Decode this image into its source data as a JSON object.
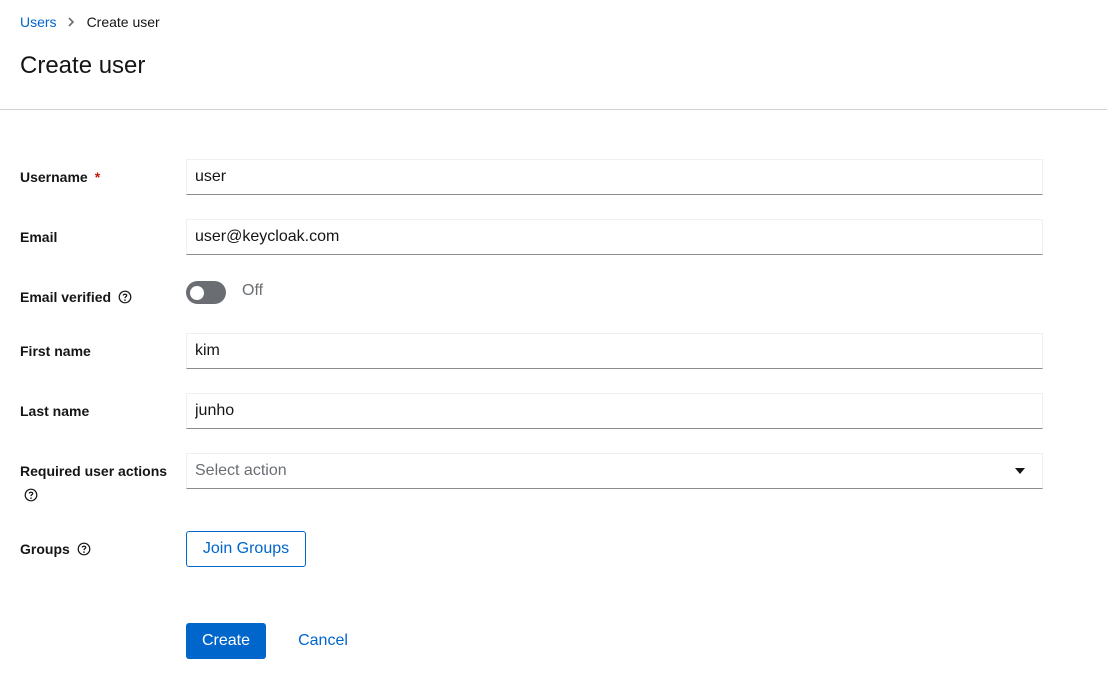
{
  "breadcrumb": {
    "parent": "Users",
    "current": "Create user"
  },
  "page": {
    "title": "Create user"
  },
  "form": {
    "username": {
      "label": "Username",
      "required_mark": "*",
      "value": "user"
    },
    "email": {
      "label": "Email",
      "value": "user@keycloak.com"
    },
    "email_verified": {
      "label": "Email verified",
      "state_text": "Off",
      "on": false
    },
    "first_name": {
      "label": "First name",
      "value": "kim"
    },
    "last_name": {
      "label": "Last name",
      "value": "junho"
    },
    "required_actions": {
      "label": "Required user actions",
      "placeholder": "Select action"
    },
    "groups": {
      "label": "Groups",
      "button_label": "Join Groups"
    }
  },
  "actions": {
    "create_label": "Create",
    "cancel_label": "Cancel"
  },
  "icons": {
    "breadcrumb_separator": "chevron-right-icon",
    "help": "help-icon",
    "dropdown": "caret-down-icon"
  },
  "colors": {
    "accent": "#0066cc",
    "required": "#c9190b",
    "toggle_off": "#6a6e73"
  }
}
